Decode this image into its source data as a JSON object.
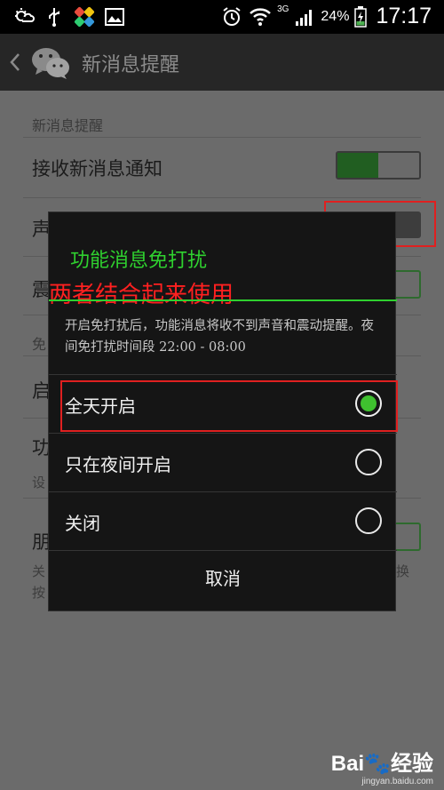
{
  "status_bar": {
    "network": "3G",
    "battery": "24%",
    "time": "17:17"
  },
  "action_bar": {
    "title": "新消息提醒",
    "icons": [
      "back-arrow-icon",
      "wechat-icon"
    ]
  },
  "settings": {
    "section_new_message": "新消息提醒",
    "receive_notification": "接收新消息通知",
    "sound_partial": "声",
    "vibrate_partial": "震",
    "section_partial": "免",
    "item_partial_1": "启",
    "item_partial_2": "功",
    "item_partial_2_sub": "设",
    "item_partial_3": "朋",
    "item_partial_3_sub1": "关",
    "item_partial_3_sub2": "按",
    "item_partial_3_sub1_end": "换"
  },
  "dialog": {
    "title": "功能消息免打扰",
    "overlay_annotation": "两者结合起来使用",
    "description": "开启免打扰后，功能消息将收不到声音和震动提醒。夜间免打扰时间段 22:00 - 08:00",
    "options": [
      {
        "label": "全天开启",
        "selected": true
      },
      {
        "label": "只在夜间开启",
        "selected": false
      },
      {
        "label": "关闭",
        "selected": false
      }
    ],
    "cancel_label": "取消"
  },
  "watermark": {
    "brand": "Bai🐾经验",
    "url": "jingyan.baidu.com"
  },
  "colors": {
    "accent_green": "#2fd12f",
    "annotation_red": "#e02020",
    "dialog_bg": "#151515"
  }
}
